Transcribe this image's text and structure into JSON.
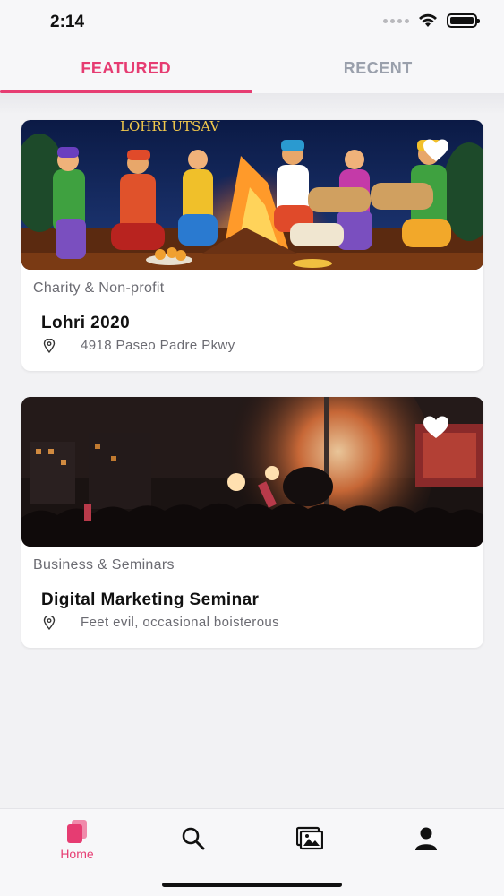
{
  "status_bar": {
    "time": "2:14"
  },
  "tabs": [
    {
      "label": "FEATURED",
      "active": true
    },
    {
      "label": "RECENT",
      "active": false
    }
  ],
  "events": [
    {
      "image_text": "LOHRI UTSAV",
      "category": "Charity & Non-profit",
      "title": "Lohri 2020",
      "address": "4918 Paseo Padre Pkwy"
    },
    {
      "category": "Business & Seminars",
      "title": "Digital Marketing Seminar",
      "address": "Feet evil, occasional boisterous"
    }
  ],
  "bottom_nav": {
    "items": [
      {
        "label": "Home",
        "icon": "home-icon",
        "active": true
      },
      {
        "label": "",
        "icon": "search-icon",
        "active": false
      },
      {
        "label": "",
        "icon": "gallery-icon",
        "active": false
      },
      {
        "label": "",
        "icon": "profile-icon",
        "active": false
      }
    ]
  },
  "colors": {
    "accent": "#e63c72",
    "inactive_tab": "#9aa0ac",
    "muted_text": "#6b6b72"
  }
}
